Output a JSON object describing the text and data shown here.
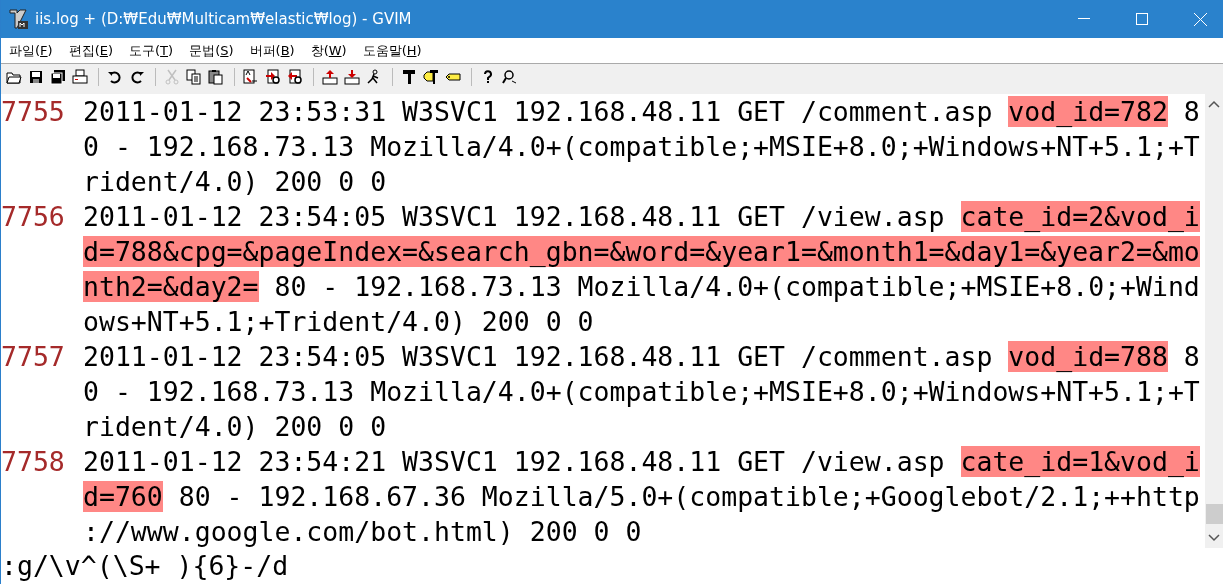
{
  "window": {
    "title": "iis.log + (D:₩Edu₩Multicam₩elastic₩log) - GVIM"
  },
  "menu": [
    "파일(F)",
    "편집(E)",
    "도구(T)",
    "문법(S)",
    "버퍼(B)",
    "창(W)",
    "도움말(H)"
  ],
  "toolbar": [
    [
      {
        "kind": "open",
        "disabled": false
      },
      {
        "kind": "save",
        "disabled": false
      },
      {
        "kind": "save-all",
        "disabled": false
      },
      {
        "kind": "print",
        "disabled": false
      }
    ],
    [
      {
        "kind": "undo",
        "disabled": false
      },
      {
        "kind": "redo",
        "disabled": false
      }
    ],
    [
      {
        "kind": "cut",
        "disabled": true
      },
      {
        "kind": "copy",
        "disabled": false
      },
      {
        "kind": "paste",
        "disabled": false
      }
    ],
    [
      {
        "kind": "replace",
        "disabled": false
      },
      {
        "kind": "find-next",
        "disabled": false
      },
      {
        "kind": "find-prev",
        "disabled": false
      }
    ],
    [
      {
        "kind": "load-session",
        "disabled": false
      },
      {
        "kind": "save-session",
        "disabled": false
      },
      {
        "kind": "run-script",
        "disabled": false
      }
    ],
    [
      {
        "kind": "make",
        "disabled": false
      },
      {
        "kind": "build-tags",
        "disabled": false
      },
      {
        "kind": "tag",
        "disabled": false
      }
    ],
    [
      {
        "kind": "help",
        "disabled": false
      },
      {
        "kind": "find-help",
        "disabled": false
      }
    ]
  ],
  "lines": [
    {
      "number": "7755",
      "rows": [
        [
          {
            "text": "2011-01-12 23:53:31 W3SVC1 192.168.48.11 GET /comment.asp ",
            "match": false
          },
          {
            "text": "vod_id=782",
            "match": true
          },
          {
            "text": " 8",
            "match": false
          }
        ],
        [
          {
            "text": "0 - 192.168.73.13 Mozilla/4.0+(compatible;+MSIE+8.0;+Windows+NT+5.1;+T",
            "match": false
          }
        ],
        [
          {
            "text": "rident/4.0) 200 0 0",
            "match": false
          }
        ]
      ]
    },
    {
      "number": "7756",
      "rows": [
        [
          {
            "text": "2011-01-12 23:54:05 W3SVC1 192.168.48.11 GET /view.asp ",
            "match": false
          },
          {
            "text": "cate_id=2&vod_i",
            "match": true
          }
        ],
        [
          {
            "text": "d=788&cpg=&pageIndex=&search_gbn=&word=&year1=&month1=&day1=&year2=&mo",
            "match": true
          }
        ],
        [
          {
            "text": "nth2=&day2=",
            "match": true
          },
          {
            "text": " 80 - 192.168.73.13 Mozilla/4.0+(compatible;+MSIE+8.0;+Wind",
            "match": false
          }
        ],
        [
          {
            "text": "ows+NT+5.1;+Trident/4.0) 200 0 0",
            "match": false
          }
        ]
      ]
    },
    {
      "number": "7757",
      "rows": [
        [
          {
            "text": "2011-01-12 23:54:05 W3SVC1 192.168.48.11 GET /comment.asp ",
            "match": false
          },
          {
            "text": "vod_id=788",
            "match": true
          },
          {
            "text": " 8",
            "match": false
          }
        ],
        [
          {
            "text": "0 - 192.168.73.13 Mozilla/4.0+(compatible;+MSIE+8.0;+Windows+NT+5.1;+T",
            "match": false
          }
        ],
        [
          {
            "text": "rident/4.0) 200 0 0",
            "match": false
          }
        ]
      ]
    },
    {
      "number": "7758",
      "rows": [
        [
          {
            "text": "2011-01-12 23:54:21 W3SVC1 192.168.48.11 GET /view.asp ",
            "match": false
          },
          {
            "text": "cate_id=1&vod_i",
            "match": true
          }
        ],
        [
          {
            "text": "d=760",
            "match": true
          },
          {
            "text": " 80 - 192.168.67.36 Mozilla/5.0+(compatible;+Googlebot/2.1;++http",
            "match": false
          }
        ],
        [
          {
            "text": "://www.google.com/bot.html) 200 0 0",
            "match": false
          }
        ]
      ]
    }
  ],
  "command_line": ":g/\\v^(\\S+ ){6}-/d"
}
